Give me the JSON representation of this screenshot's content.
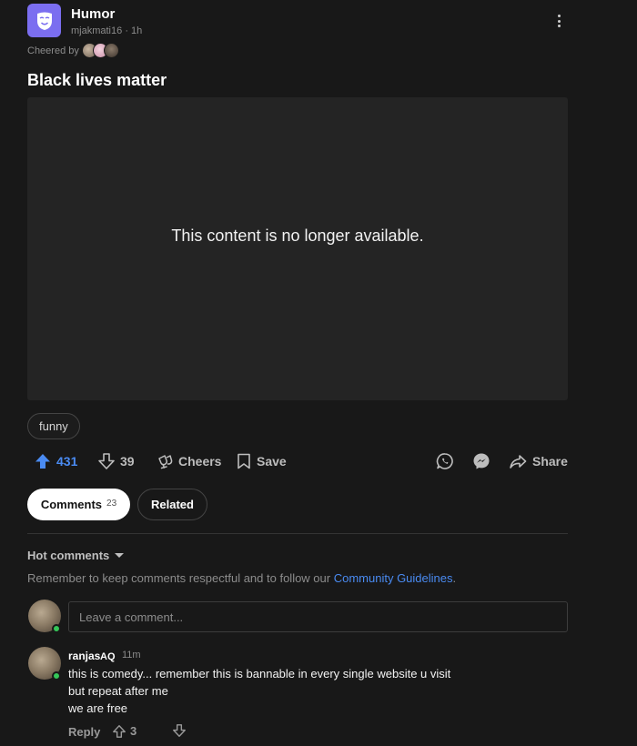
{
  "post": {
    "community": "Humor",
    "author": "mjakmati16",
    "separator": "·",
    "age": "1h",
    "cheered_by_label": "Cheered by",
    "title": "Black lives matter",
    "media_message": "This content is no longer available.",
    "tags": [
      "funny"
    ]
  },
  "actions": {
    "upvotes": "431",
    "downvotes": "39",
    "cheers_label": "Cheers",
    "save_label": "Save",
    "share_label": "Share"
  },
  "tabs": {
    "comments_label": "Comments",
    "comments_count": "23",
    "related_label": "Related"
  },
  "comments": {
    "sort_label": "Hot comments",
    "guidelines_prefix": "Remember to keep comments respectful and to follow our ",
    "guidelines_link": "Community Guidelines",
    "guidelines_suffix": ".",
    "input_placeholder": "Leave a comment...",
    "items": [
      {
        "author": "ranjas",
        "badge": "AQ",
        "age": "11m",
        "lines": [
          "this is comedy... remember this is bannable in every single website u visit",
          "but repeat after me",
          "we are free"
        ],
        "reply_label": "Reply",
        "upvotes": "3"
      }
    ]
  },
  "colors": {
    "background": "#181818",
    "accent": "#4a8bf2",
    "community_avatar": "#7b6ef0",
    "online": "#35c759",
    "media_background": "#242424"
  }
}
